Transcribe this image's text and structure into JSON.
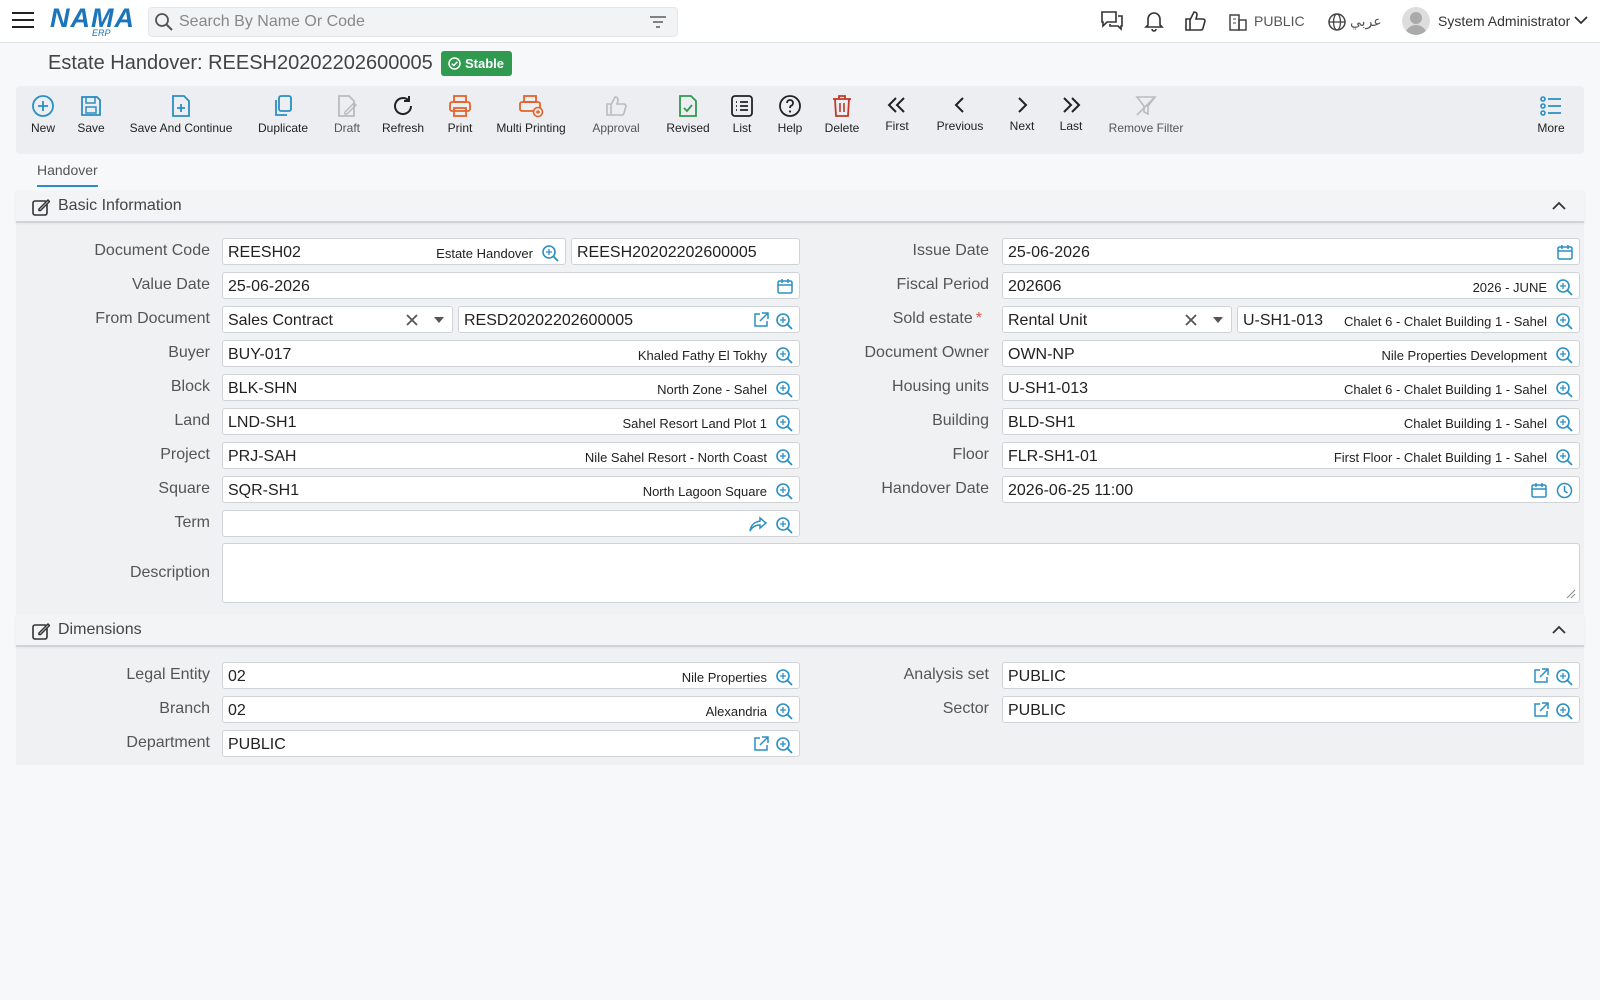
{
  "header": {
    "search_placeholder": "Search By Name Or Code",
    "logo_text": "NAMA",
    "logo_sub": "ERP",
    "entity": "PUBLIC",
    "lang": "عربي",
    "user": "System Administrator"
  },
  "page": {
    "title": "Estate Handover: REESH20202202600005",
    "status": "Stable"
  },
  "toolbar": {
    "new": "New",
    "save": "Save",
    "save_continue": "Save And Continue",
    "duplicate": "Duplicate",
    "draft": "Draft",
    "refresh": "Refresh",
    "print": "Print",
    "multi_printing": "Multi Printing",
    "approval": "Approval",
    "revised": "Revised",
    "list": "List",
    "help": "Help",
    "delete": "Delete",
    "first": "First",
    "previous": "Previous",
    "next": "Next",
    "last": "Last",
    "remove_filter": "Remove Filter",
    "more": "More"
  },
  "tabs": {
    "handover": "Handover"
  },
  "basic": {
    "title": "Basic Information",
    "document_code": {
      "label": "Document Code",
      "code": "REESH02",
      "name": "Estate Handover",
      "number": "REESH20202202600005"
    },
    "value_date": {
      "label": "Value Date",
      "value": "25-06-2026"
    },
    "from_document": {
      "label": "From Document",
      "type": "Sales Contract",
      "value": "RESD20202202600005"
    },
    "buyer": {
      "label": "Buyer",
      "code": "BUY-017",
      "name": "Khaled Fathy El Tokhy"
    },
    "block": {
      "label": "Block",
      "code": "BLK-SHN",
      "name": "North Zone - Sahel"
    },
    "land": {
      "label": "Land",
      "code": "LND-SH1",
      "name": "Sahel Resort Land Plot 1"
    },
    "project": {
      "label": "Project",
      "code": "PRJ-SAH",
      "name": "Nile Sahel Resort - North Coast"
    },
    "square": {
      "label": "Square",
      "code": "SQR-SH1",
      "name": "North Lagoon Square"
    },
    "term": {
      "label": "Term",
      "value": ""
    },
    "issue_date": {
      "label": "Issue Date",
      "value": "25-06-2026"
    },
    "fiscal_period": {
      "label": "Fiscal Period",
      "code": "202606",
      "name": "2026 - JUNE"
    },
    "sold_estate": {
      "label": "Sold estate",
      "type": "Rental Unit",
      "code": "U-SH1-013",
      "name": "Chalet 6 - Chalet Building 1 - Sahel"
    },
    "document_owner": {
      "label": "Document Owner",
      "code": "OWN-NP",
      "name": "Nile Properties Development"
    },
    "housing_units": {
      "label": "Housing units",
      "code": "U-SH1-013",
      "name": "Chalet 6 - Chalet Building 1 - Sahel"
    },
    "building": {
      "label": "Building",
      "code": "BLD-SH1",
      "name": "Chalet Building 1 - Sahel"
    },
    "floor": {
      "label": "Floor",
      "code": "FLR-SH1-01",
      "name": "First Floor - Chalet Building 1 - Sahel"
    },
    "handover_date": {
      "label": "Handover Date",
      "value": "2026-06-25 11:00"
    },
    "description": {
      "label": "Description",
      "value": ""
    }
  },
  "dimensions": {
    "title": "Dimensions",
    "legal_entity": {
      "label": "Legal Entity",
      "code": "02",
      "name": "Nile Properties"
    },
    "branch": {
      "label": "Branch",
      "code": "02",
      "name": "Alexandria"
    },
    "department": {
      "label": "Department",
      "code": "PUBLIC"
    },
    "analysis_set": {
      "label": "Analysis set",
      "code": "PUBLIC"
    },
    "sector": {
      "label": "Sector",
      "code": "PUBLIC"
    }
  },
  "colors": {
    "accent": "#2a8fc4",
    "stable": "#2f9a50",
    "print": "#e5622a"
  }
}
